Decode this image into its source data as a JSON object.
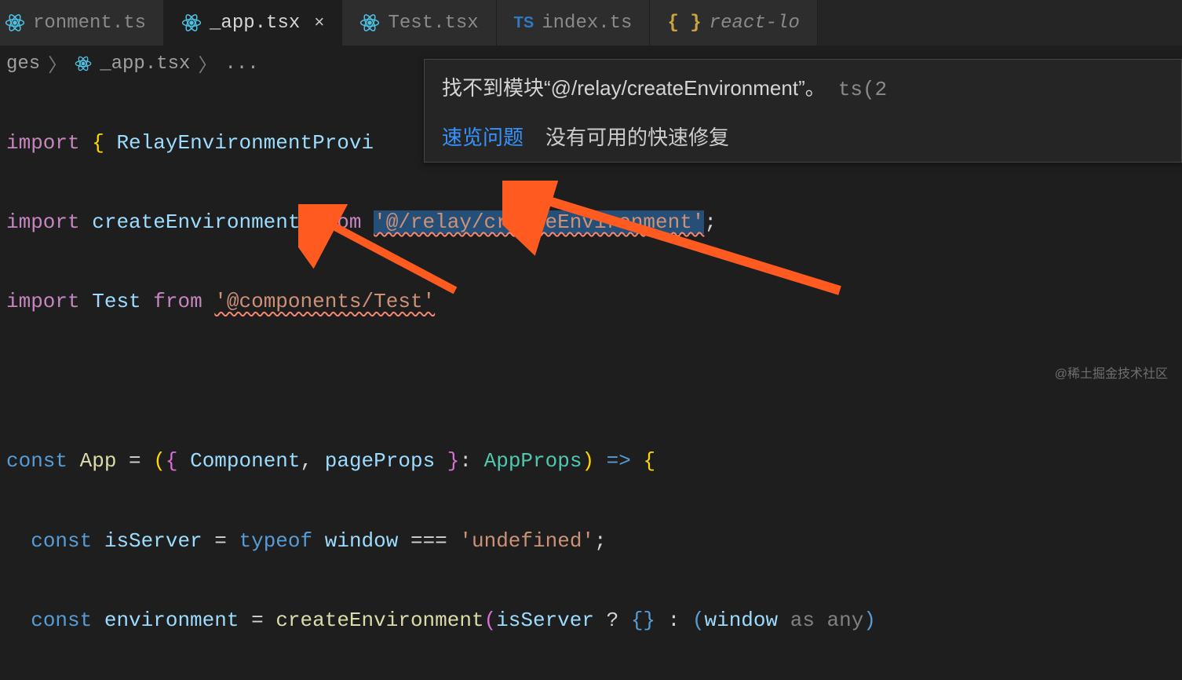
{
  "tabs": [
    {
      "label": "ronment.ts",
      "icon": "react"
    },
    {
      "label": "_app.tsx",
      "icon": "react",
      "active": true,
      "close": "×"
    },
    {
      "label": "Test.tsx",
      "icon": "react"
    },
    {
      "label": "index.ts",
      "icon": "ts",
      "tsLabel": "TS"
    },
    {
      "label": "react-lo",
      "icon": "json",
      "jsonLabel": "{ }",
      "italic": true
    }
  ],
  "breadcrumb": {
    "seg0": "ges",
    "fileIcon": "react",
    "file": "_app.tsx",
    "more": "..."
  },
  "hover": {
    "message": "找不到模块“@/relay/createEnvironment”。",
    "tscode": "ts(2",
    "peek": "速览问题",
    "nofix": "没有可用的快速修复"
  },
  "code": {
    "import": "import",
    "from": "from",
    "const": "const",
    "typeof": "typeof",
    "line1_name": "RelayEnvironmentProvi",
    "line2_name": "createEnvironment",
    "line2_path": "'@/relay/createEnvironment'",
    "line3_name": "Test",
    "line3_path": "'@components/Test'",
    "app": "App",
    "eq": "=",
    "component": "Component",
    "pageProps": "pageProps",
    "appProps": "AppProps",
    "arrow": "=>",
    "isServer": "isServer",
    "window": "window",
    "teq": "===",
    "undef": "'undefined'",
    "environment": "environment",
    "createEnvCall": "createEnvironment",
    "cond_isServer": "isServer",
    "qmark": "?",
    "colon": ":",
    "windowAs": "window",
    "as": "as",
    "any": "any"
  },
  "watermark": "@稀土掘金技术社区"
}
